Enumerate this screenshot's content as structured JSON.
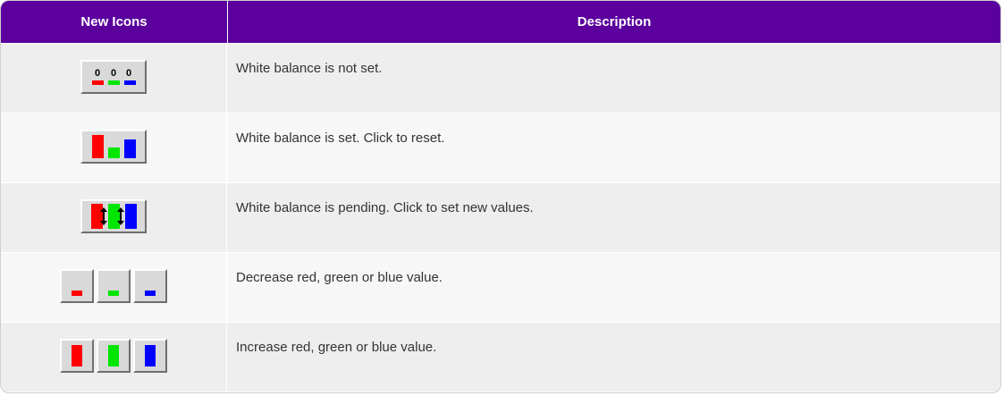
{
  "table": {
    "headers": [
      "New Icons",
      "Description"
    ],
    "rows": [
      {
        "icon": "white-balance-not-set-icon",
        "zeros": [
          "0",
          "0",
          "0"
        ],
        "description": "White balance is not set."
      },
      {
        "icon": "white-balance-set-icon",
        "description": "White balance is set. Click to reset."
      },
      {
        "icon": "white-balance-pending-icon",
        "description": "White balance is pending. Click to set new values."
      },
      {
        "icon": "decrease-rgb-icons",
        "description": "Decrease red, green or blue value."
      },
      {
        "icon": "increase-rgb-icons",
        "description": "Increase red, green or blue value."
      }
    ]
  },
  "colors": {
    "header_bg": "#5b009d",
    "red": "#ff0000",
    "green": "#00e600",
    "blue": "#0000ff"
  }
}
